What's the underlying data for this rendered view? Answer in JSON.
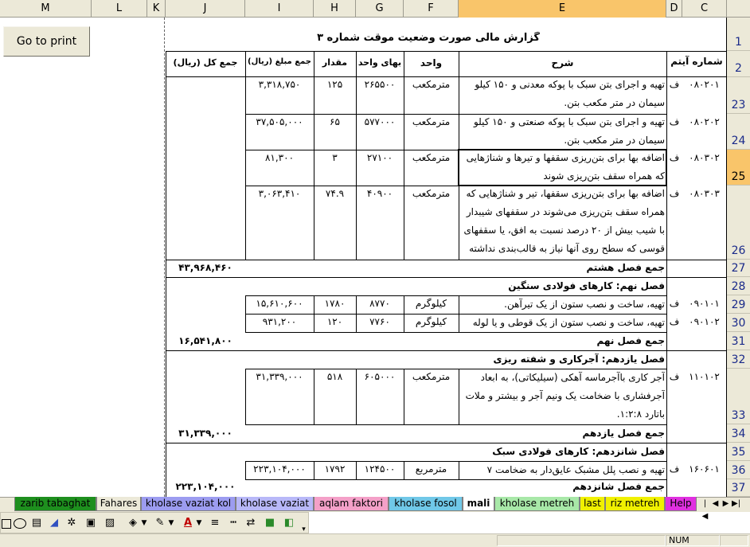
{
  "columns": [
    "M",
    "L",
    "K",
    "J",
    "I",
    "H",
    "G",
    "F",
    "E",
    "D",
    "C"
  ],
  "print_button": "Go to print",
  "title": "گزارش مالی صورت وضعیت موقت شماره ۳",
  "headers": {
    "item_no": "شماره آیتم",
    "description": "شرح",
    "unit": "واحد",
    "unit_price": "بهای واحد",
    "quantity": "مقدار",
    "amount": "جمع مبلغ (ریال)",
    "total": "جمع کل (ریال)"
  },
  "row_numbers": [
    "1",
    "2",
    "23",
    "24",
    "25",
    "26",
    "27",
    "28",
    "29",
    "30",
    "31",
    "32",
    "33",
    "34",
    "35",
    "36",
    "37"
  ],
  "items": [
    {
      "code": "۰۸۰۲۰۱",
      "prefix": "ف",
      "desc": "تهیه و اجرای بتن سبک با پوکه معدنی و ۱۵۰ کیلو سیمان در متر مکعب بتن.",
      "unit": "مترمکعب",
      "price": "۲۶۵۵۰۰",
      "qty": "۱۲۵",
      "amount": "۳,۳۱۸,۷۵۰"
    },
    {
      "code": "۰۸۰۲۰۲",
      "prefix": "ف",
      "desc": "تهیه و اجرای بتن سبک با پوکه صنعتی و ۱۵۰ کیلو سیمان در متر مکعب بتن.",
      "unit": "مترمکعب",
      "price": "۵۷۷۰۰۰",
      "qty": "۶۵",
      "amount": "۳۷,۵۰۵,۰۰۰"
    },
    {
      "code": "۰۸۰۳۰۲",
      "prefix": "ف",
      "desc": "اضافه بها برای بتن‌ریزی سقفها و تیرها و شناژهایی که همراه سقف بتن‌ریزی شوند",
      "unit": "مترمکعب",
      "price": "۲۷۱۰۰",
      "qty": "۳",
      "amount": "۸۱,۳۰۰"
    },
    {
      "code": "۰۸۰۳۰۳",
      "prefix": "ف",
      "desc": "اضافه بها برای بتن‌ریزی سقفها، تیر و شناژهایی که همراه سقف بتن‌ریزی می‌شوند در سقفهای شیبدار با شیب بیش از ۲۰ درصد نسبت به افق، یا سقفهای قوسی که سطح روی آنها نیاز به قالب‌بندی نداشته",
      "unit": "مترمکعب",
      "price": "۴۰۹۰۰",
      "qty": "۷۴.۹",
      "amount": "۳,۰۶۳,۴۱۰"
    },
    {
      "code": "۰۹۰۱۰۱",
      "prefix": "ف",
      "desc": "تهیه، ساخت و نصب ستون از یک تیرآهن.",
      "unit": "کیلوگرم",
      "price": "۸۷۷۰",
      "qty": "۱۷۸۰",
      "amount": "۱۵,۶۱۰,۶۰۰"
    },
    {
      "code": "۰۹۰۱۰۲",
      "prefix": "ف",
      "desc": "تهیه، ساخت و نصب ستون از یک قوطی و یا لوله",
      "unit": "کیلوگرم",
      "price": "۷۷۶۰",
      "qty": "۱۲۰",
      "amount": "۹۳۱,۲۰۰"
    },
    {
      "code": "۱۱۰۱۰۲",
      "prefix": "ف",
      "desc": "آجر کاری باآجرماسه آهکی (سیلیکاتی)، به ابعاد آجرفشاری با ضخامت یک ونیم آجر و بیشتر و ملات باتارد ۱:۲:۸.",
      "unit": "مترمکعب",
      "price": "۶۰۵۰۰۰",
      "qty": "۵۱۸",
      "amount": "۳۱,۳۳۹,۰۰۰"
    },
    {
      "code": "۱۶۰۶۰۱",
      "prefix": "ف",
      "desc": "تهیه و نصب پلل مشبک عایق‌دار به ضخامت ۷",
      "unit": "مترمربع",
      "price": "۱۲۴۵۰۰",
      "qty": "۱۷۹۲",
      "amount": "۲۲۳,۱۰۴,۰۰۰"
    }
  ],
  "sections": {
    "sum8": "جمع فصل هشتم",
    "sec9": "فصل نهم: کارهای فولادی سنگین",
    "sum9": "جمع فصل نهم",
    "sec11": "فصل یازدهم: آجرکاری و شفته ریزی",
    "sum11": "جمع فصل یازدهم",
    "sec16": "فصل شانزدهم: کارهای فولادی سبک",
    "sum16": "جمع فصل شانزدهم"
  },
  "totals": {
    "sum8": "۴۳,۹۶۸,۴۶۰",
    "sum9": "۱۶,۵۴۱,۸۰۰",
    "sum11": "۳۱,۳۳۹,۰۰۰",
    "sum16": "۲۲۳,۱۰۴,۰۰۰"
  },
  "tabs": [
    {
      "label": "zarib tabaghat",
      "color": "#1e8f1e"
    },
    {
      "label": "Fahares",
      "color": "#ece9d8"
    },
    {
      "label": "kholase vaziat kol",
      "color": "#9c9cf0"
    },
    {
      "label": "kholase vaziat",
      "color": "#b8b8f8"
    },
    {
      "label": "aqlam faktori",
      "color": "#f4a0c8"
    },
    {
      "label": "kholase fosol",
      "color": "#70c8e8"
    },
    {
      "label": "mali",
      "color": "#ffffff"
    },
    {
      "label": "kholase metreh",
      "color": "#a8e8a8"
    },
    {
      "label": "last",
      "color": "#f0f000"
    },
    {
      "label": "riz metreh",
      "color": "#f0f000"
    },
    {
      "label": "Help",
      "color": "#e030e0"
    }
  ],
  "status": {
    "num": "NUM"
  }
}
